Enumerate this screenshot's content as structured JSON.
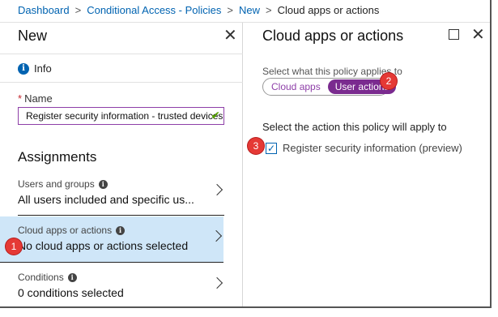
{
  "breadcrumb": {
    "items": [
      "Dashboard",
      "Conditional Access - Policies",
      "New",
      "Cloud apps or actions"
    ],
    "separator": ">"
  },
  "left_blade": {
    "title": "New",
    "close_glyph": "✕",
    "info_label": "Info",
    "name_label": "Name",
    "required_marker": "*",
    "name_value": "Register security information - trusted devices",
    "assignments_heading": "Assignments",
    "items": [
      {
        "label": "Users and groups",
        "value": "All users included and specific us..."
      },
      {
        "label": "Cloud apps or actions",
        "value": "No cloud apps or actions selected"
      },
      {
        "label": "Conditions",
        "value": "0 conditions selected"
      }
    ]
  },
  "right_blade": {
    "title": "Cloud apps or actions",
    "applies_label": "Select what this policy applies to",
    "toggle_options": [
      "Cloud apps",
      "User actions"
    ],
    "selected_option": "User actions",
    "action_label": "Select the action this policy will apply to",
    "checkbox_label": "Register security information (preview)",
    "checkbox_checked": true
  },
  "callouts": [
    "1",
    "2",
    "3"
  ],
  "colors": {
    "link": "#0063b1",
    "accent_purple": "#7a2b8f",
    "active_row": "#cfe6f8",
    "callout": "#e53935",
    "valid_check": "#57a300"
  }
}
